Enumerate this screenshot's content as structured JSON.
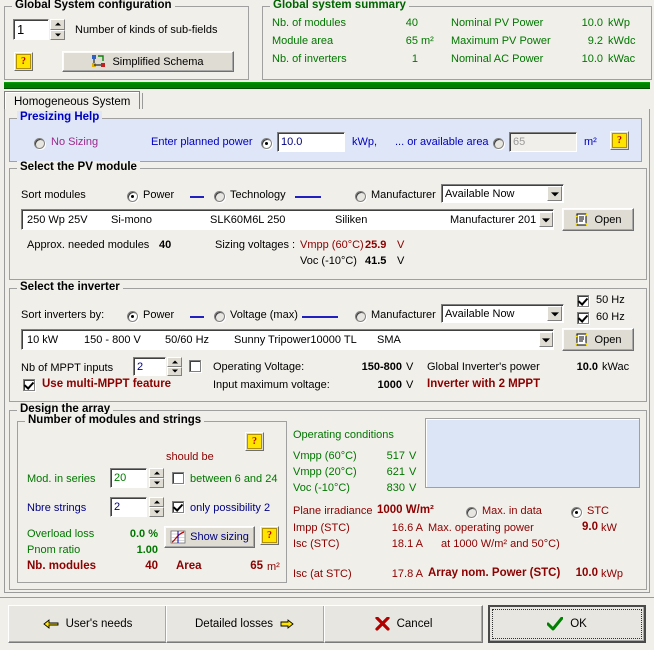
{
  "top": {
    "config": {
      "title": "Global System configuration",
      "subfields_value": "1",
      "subfields_label": "Number of kinds of sub-fields",
      "schema_button": "Simplified Schema",
      "help": "?"
    },
    "summary": {
      "title": "Global system summary",
      "rows": [
        {
          "label": "Nb. of modules",
          "value": "40",
          "unit": "",
          "label2": "Nominal PV Power",
          "value2": "10.0",
          "unit2": "kWp"
        },
        {
          "label": "Module area",
          "value": "65",
          "unit": "m²",
          "label2": "Maximum PV Power",
          "value2": "9.2",
          "unit2": "kWdc"
        },
        {
          "label": "Nb. of inverters",
          "value": "1",
          "unit": "",
          "label2": "Nominal AC Power",
          "value2": "10.0",
          "unit2": "kWac"
        }
      ]
    }
  },
  "tab": {
    "label": "Homogeneous System"
  },
  "presizing": {
    "title": "Presizing Help",
    "no_sizing": "No Sizing",
    "no_sizing_selected": false,
    "enter_power_label": "Enter planned power",
    "power_selected": true,
    "power_value": "10.0",
    "power_unit": "kWp,",
    "area_label": "... or available area",
    "area_selected": false,
    "area_value": "65",
    "area_unit": "m²",
    "help": "?"
  },
  "pv_module": {
    "title": "Select the PV module",
    "sort_label": "Sort modules",
    "sort_power": "Power",
    "sort_technology": "Technology",
    "sort_manufacturer": "Manufacturer",
    "sort_selected": "Power",
    "availability": "Available Now",
    "module": {
      "power": "250 Wp 25V",
      "technology": "Si-mono",
      "model": "SLK60M6L 250",
      "manufacturer": "Siliken",
      "source": "Manufacturer 201"
    },
    "open_button": "Open",
    "approx_label": "Approx. needed modules",
    "approx_value": "40",
    "sizing_voltages_label": "Sizing voltages :",
    "vmpp_label": "Vmpp (60°C)",
    "vmpp_value": "25.9",
    "vmpp_unit": "V",
    "voc_label": "Voc  (-10°C)",
    "voc_value": "41.5",
    "voc_unit": "V"
  },
  "inverter": {
    "title": "Select the inverter",
    "sort_label": "Sort inverters by:",
    "sort_power": "Power",
    "sort_voltage": "Voltage (max)",
    "sort_manufacturer": "Manufacturer",
    "sort_selected": "Power",
    "availability": "Available Now",
    "hz50_label": "50 Hz",
    "hz50_checked": true,
    "hz60_label": "60 Hz",
    "hz60_checked": true,
    "device": {
      "power": "10 kW",
      "voltage": "150 - 800 V",
      "freq": "50/60 Hz",
      "model": "Sunny Tripower10000 TL",
      "manufacturer": "SMA"
    },
    "open_button": "Open",
    "mppt_label": "Nb of MPPT inputs",
    "mppt_value": "2",
    "mppt_extra_checked": false,
    "multi_mppt_label": "Use multi-MPPT feature",
    "multi_mppt_checked": true,
    "operating_voltage_label": "Operating Voltage:",
    "operating_voltage_value": "150-800",
    "operating_voltage_unit": "V",
    "input_max_label": "Input maximum voltage:",
    "input_max_value": "1000",
    "input_max_unit": "V",
    "global_power_label": "Global Inverter's power",
    "global_power_value": "10.0",
    "global_power_unit": "kWac",
    "mppt_note": "Inverter with 2 MPPT"
  },
  "design": {
    "title": "Design the array",
    "modules_strings": {
      "title": "Number of modules and strings",
      "help": "?",
      "should_be": "should be",
      "mod_series_label": "Mod. in series",
      "mod_series_value": "20",
      "between_label": "between 6 and 24",
      "between_checked": false,
      "strings_label": "Nbre strings",
      "strings_value": "2",
      "only_possibility_label": "only possibility 2",
      "only_possibility_checked": true,
      "overload_label": "Overload loss",
      "overload_value": "0.0 %",
      "pnom_label": "Pnom ratio",
      "pnom_value": "1.00",
      "show_sizing_button": "Show sizing",
      "help2": "?",
      "nb_modules_label": "Nb. modules",
      "nb_modules_value": "40",
      "area_label": "Area",
      "area_value": "65",
      "area_unit": "m²"
    },
    "operating": {
      "title": "Operating conditions",
      "rows": [
        {
          "label": "Vmpp (60°C)",
          "value": "517",
          "unit": "V"
        },
        {
          "label": "Vmpp (20°C)",
          "value": "621",
          "unit": "V"
        },
        {
          "label": "Voc  (-10°C)",
          "value": "830",
          "unit": "V"
        }
      ],
      "plane_irradiance_label": "Plane irradiance",
      "plane_irradiance_value": "1000 W/m²",
      "max_in_data_label": "Max. in data",
      "max_in_data_selected": false,
      "stc_label": "STC",
      "stc_selected": true,
      "impp_label": "Impp (STC)",
      "impp_value": "16.6 A",
      "max_op_power_label": "Max. operating power",
      "max_op_power_value": "9.0",
      "max_op_power_unit": "kW",
      "isc_label": "Isc  (STC)",
      "isc_value": "18.1 A",
      "isc_note": "at 1000 W/m² and 50°C)",
      "isc_stc_label": "Isc (at STC)",
      "isc_stc_value": "17.8 A",
      "array_power_label": "Array nom. Power (STC)",
      "array_power_value": "10.0",
      "array_power_unit": "kWp"
    }
  },
  "footer": {
    "users_needs": "User's needs",
    "detailed_losses": "Detailed losses",
    "cancel": "Cancel",
    "ok": "OK"
  },
  "colors": {
    "green": "#007700",
    "blue": "#0000bf",
    "darkred": "#8b1a1a",
    "accentbar": "#008000",
    "panel": "#dce5f5"
  }
}
